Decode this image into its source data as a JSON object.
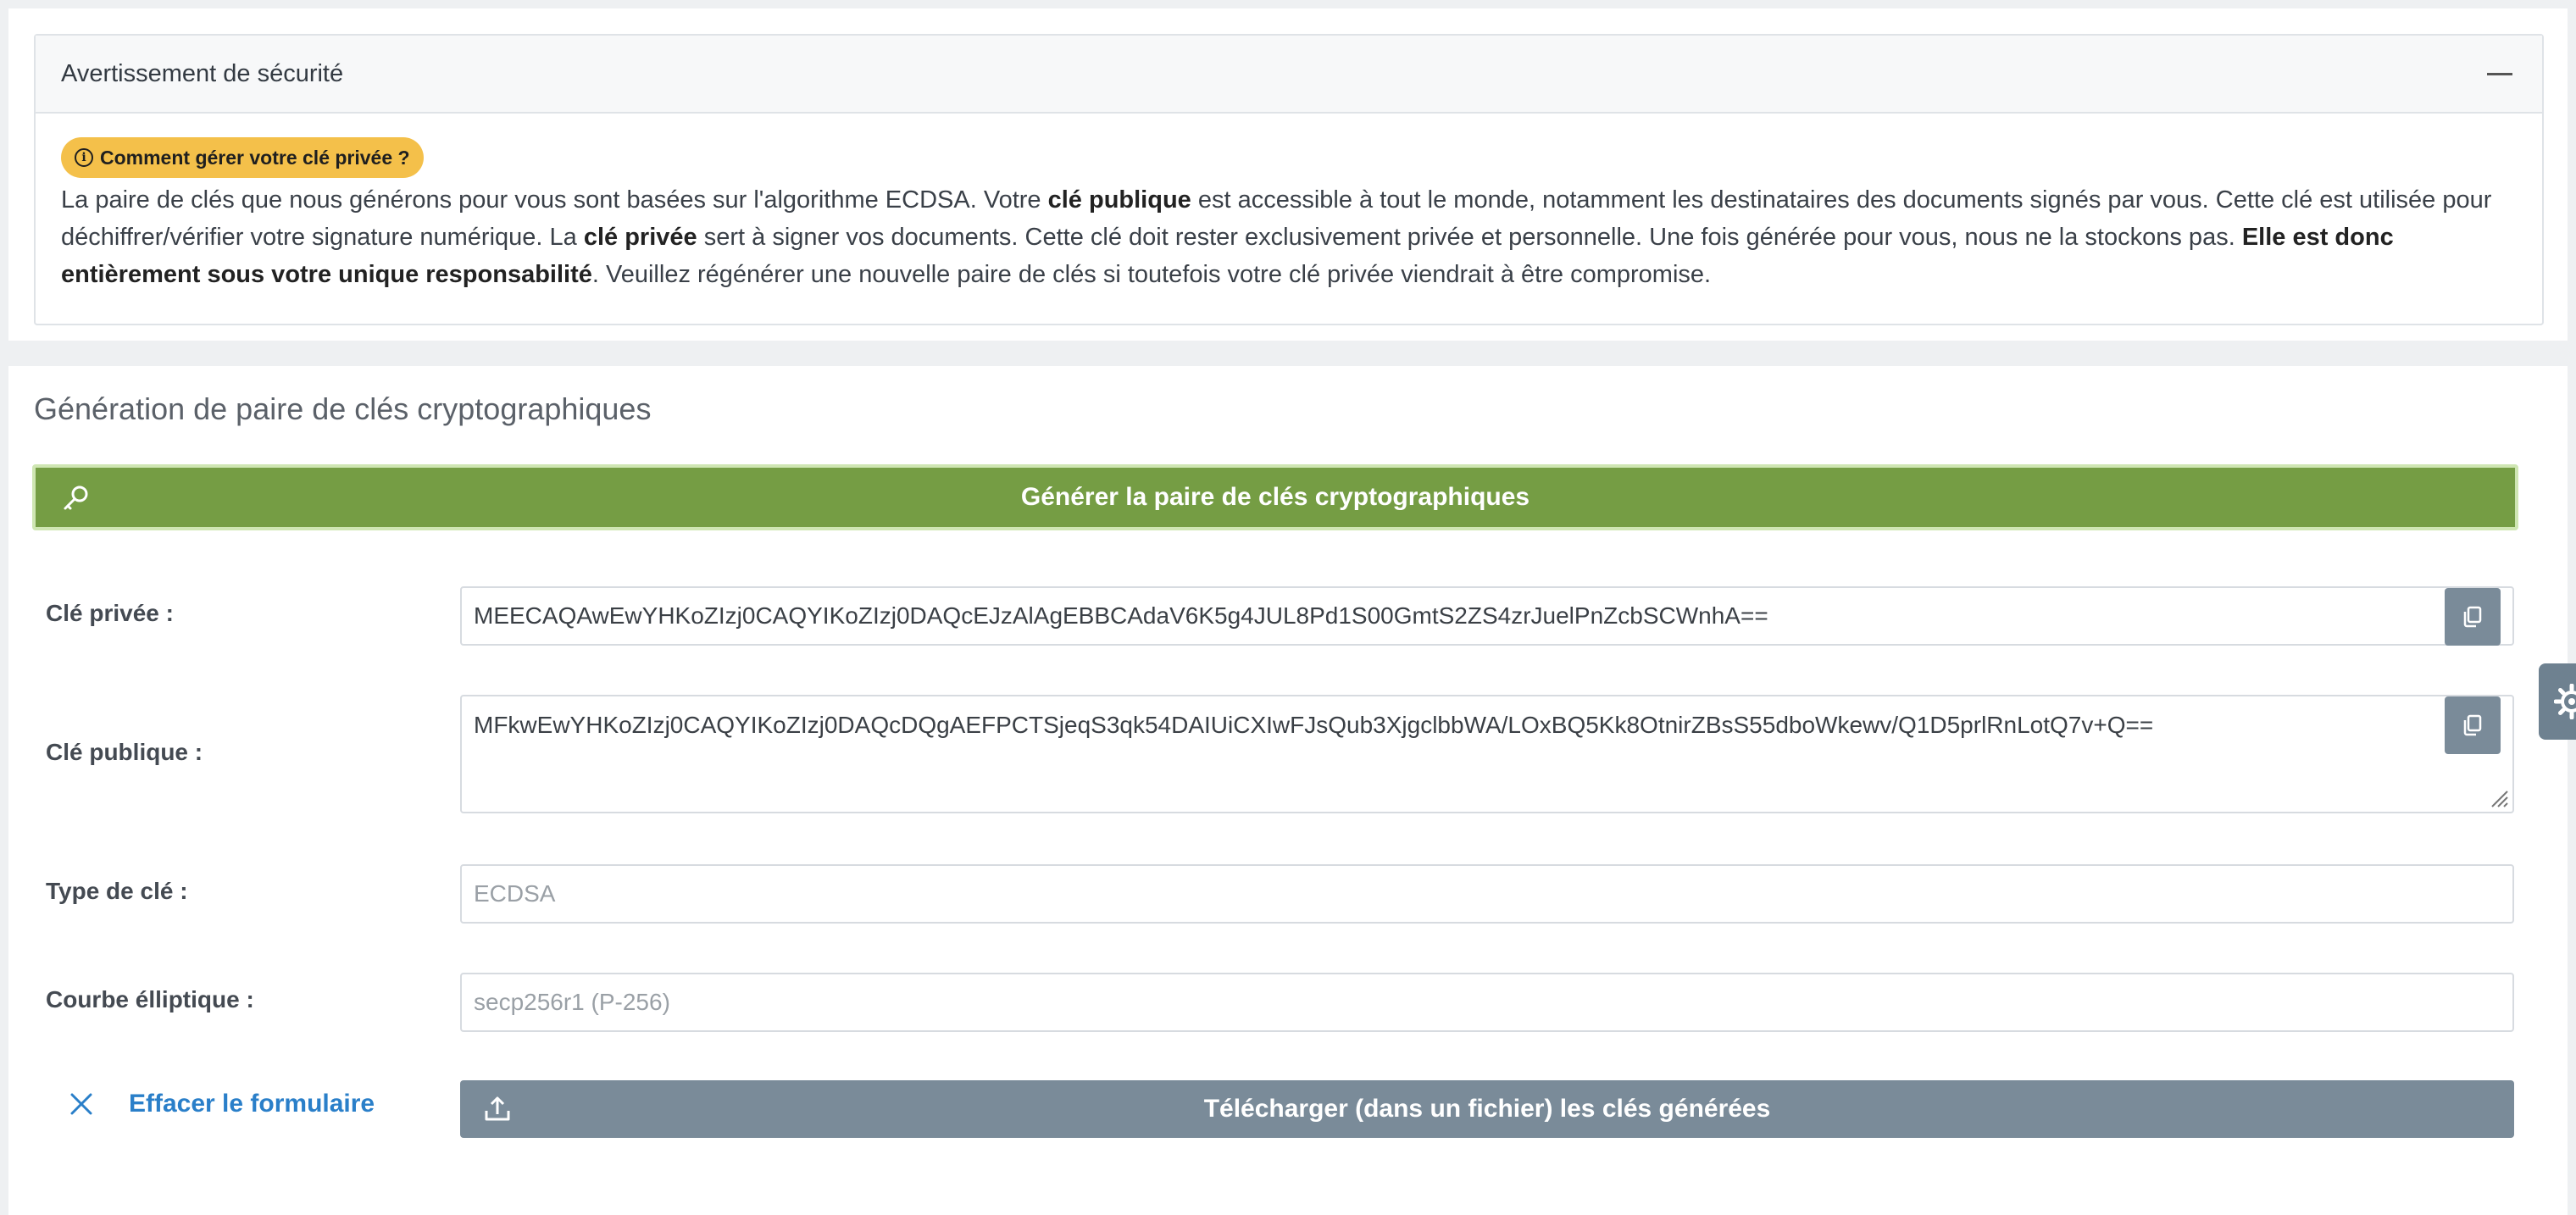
{
  "warning": {
    "title": "Avertissement de sécurité",
    "badge": "Comment gérer votre clé privée ?",
    "p1": "La paire de clés que nous générons pour vous sont basées sur l'algorithme ECDSA. Votre ",
    "b1": "clé publique",
    "p2": " est accessible à tout le monde, notamment les destinataires des documents signés par vous. Cette clé est utilisée pour déchiffrer/vérifier votre signature numérique. La ",
    "b2": "clé privée",
    "p3": " sert à signer vos documents. Cette clé doit rester exclusivement privée et personnelle. Une fois générée pour vous, nous ne la stockons pas. ",
    "b3": "Elle est donc entièrement sous votre unique responsabilité",
    "p4": ". Veuillez régénérer une nouvelle paire de clés si toutefois votre clé privée viendrait à être compromise."
  },
  "generator": {
    "title": "Génération de paire de clés cryptographiques",
    "generate_label": "Générer la paire de clés cryptographiques",
    "private_key_label": "Clé privée :",
    "private_key_value": "MEECAQAwEwYHKoZIzj0CAQYIKoZIzj0DAQcEJzAlAgEBBCAdaV6K5g4JUL8Pd1S00GmtS2ZS4zrJuelPnZcbSCWnhA==",
    "public_key_label": "Clé publique :",
    "public_key_value": "MFkwEwYHKoZIzj0CAQYIKoZIzj0DAQcDQgAEFPCTSjeqS3qk54DAIUiCXIwFJsQub3XjgclbbWA/LOxBQ5Kk8OtnirZBsS55dboWkewv/Q1D5prlRnLotQ7v+Q==",
    "key_type_label": "Type de clé :",
    "key_type_value": "ECDSA",
    "curve_label": "Courbe élliptique :",
    "curve_value": "secp256r1 (P-256)",
    "clear_label": "Effacer le formulaire",
    "download_label": "Télécharger (dans un fichier) les clés générées"
  },
  "icons": {
    "collapse": "minus-icon",
    "info": "info-circle-icon",
    "generate": "key-icon",
    "copy": "copy-icon",
    "clear": "close-icon",
    "download": "upload-icon",
    "settings": "gear-icon"
  },
  "colors": {
    "generate_button": "#759d44",
    "badge": "#f4c04a",
    "secondary_button": "#7a8b99",
    "link": "#2a7fc9"
  }
}
